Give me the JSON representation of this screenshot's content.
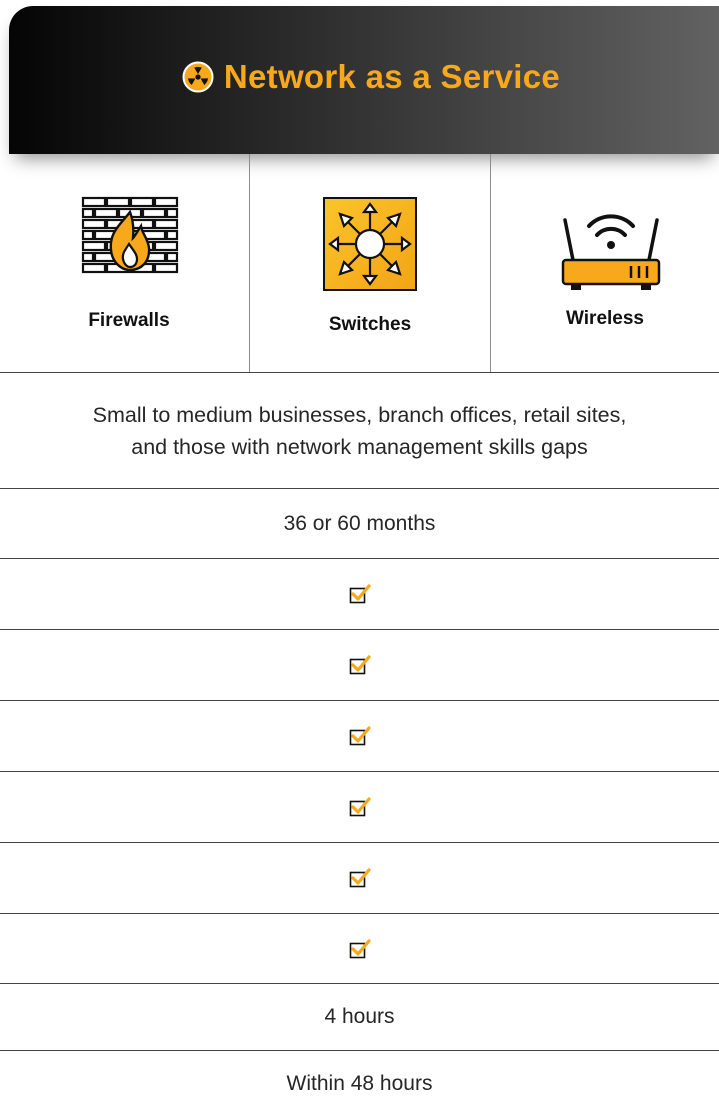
{
  "header": {
    "title": "Network as a Service",
    "icon": "radiation-icon"
  },
  "products": [
    {
      "label": "Firewalls",
      "icon": "firewall-icon"
    },
    {
      "label": "Switches",
      "icon": "switch-icon"
    },
    {
      "label": "Wireless",
      "icon": "wireless-router-icon"
    }
  ],
  "rows": {
    "ideal_for_line1": "Small to medium businesses, branch offices, retail sites,",
    "ideal_for_line2": "and those with network management skills gaps",
    "term": "36 or 60 months",
    "included_features": [
      true,
      true,
      true,
      true,
      true,
      true
    ],
    "response_time": "4 hours",
    "replacement_time": "Within 48 hours"
  },
  "colors": {
    "accent": "#f7a81b",
    "header_dark": "#050505",
    "header_light": "#626262",
    "divider": "#444444"
  }
}
